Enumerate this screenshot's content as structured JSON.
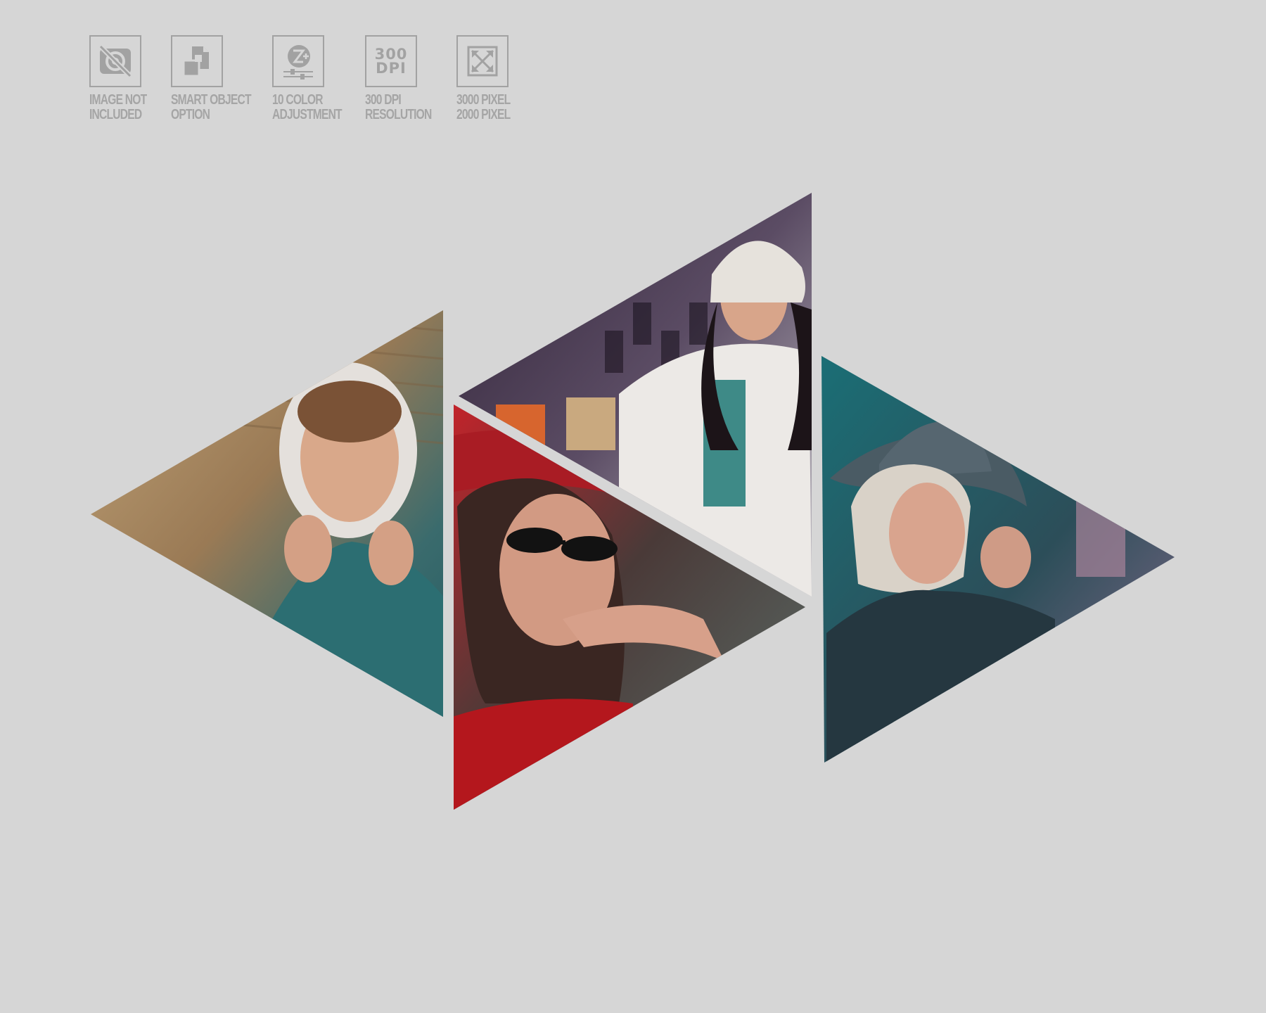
{
  "features": [
    {
      "icon": "image-not-included-icon",
      "line1": "IMAGE NOT",
      "line2": "INCLUDED"
    },
    {
      "icon": "smart-object-icon",
      "line1": "SMART OBJECT",
      "line2": "OPTION"
    },
    {
      "icon": "color-adjustment-icon",
      "line1": "10 COLOR",
      "line2": "ADJUSTMENT"
    },
    {
      "icon": "dpi-icon",
      "icon_text_1": "300",
      "icon_text_2": "DPI",
      "line1": "300 DPI",
      "line2": "RESOLUTION"
    },
    {
      "icon": "pixel-size-icon",
      "line1": "3000 PIXEL",
      "line2": "2000 PIXEL"
    }
  ],
  "photos": [
    {
      "name": "photo-woman-headscarf",
      "palette": [
        "#b79a72",
        "#8a6a4a",
        "#2f6a6e"
      ]
    },
    {
      "name": "photo-woman-beanie",
      "palette": [
        "#3d2e48",
        "#7a6d86",
        "#e9e7e5"
      ]
    },
    {
      "name": "photo-woman-red-hat",
      "palette": [
        "#b71c22",
        "#3a3434",
        "#5a6a66"
      ]
    },
    {
      "name": "photo-woman-grey-hat",
      "palette": [
        "#1f6e73",
        "#3d5660",
        "#9a6e8a"
      ]
    }
  ],
  "colors": {
    "background": "#d6d6d6",
    "icon_gray": "#a2a2a2"
  }
}
